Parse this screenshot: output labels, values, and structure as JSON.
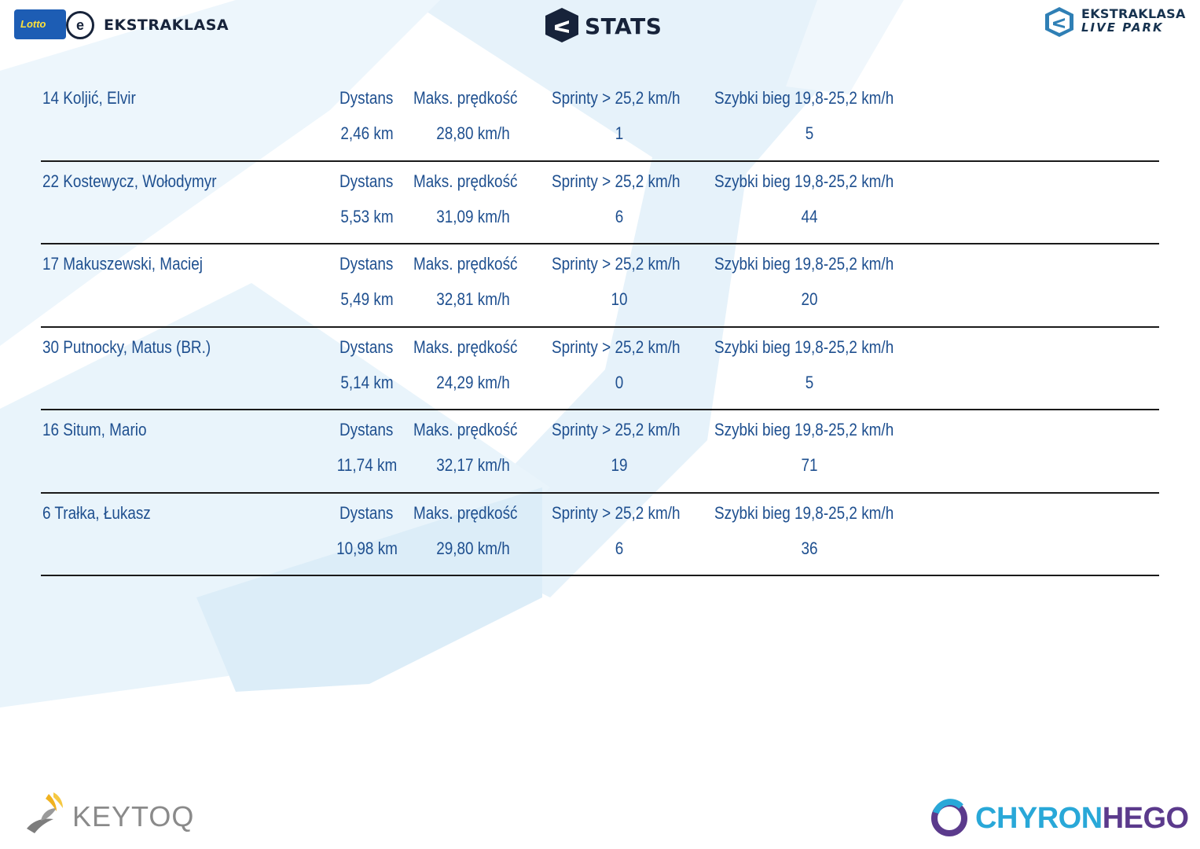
{
  "header": {
    "left_logo": {
      "badge_text": "Lotto",
      "ball_letter": "e",
      "name": "EKSTRAKLASA"
    },
    "center_logo": {
      "text": "STATS"
    },
    "right_logo": {
      "line1": "EKSTRAKLASA",
      "line2": "LIVE PARK"
    }
  },
  "players": [
    {
      "name": "14  Koljić, Elvir",
      "dist_label": "Dystans",
      "max_label": "Maks. prędkość",
      "spr_label": "Sprinty > 25,2 km/h",
      "fast_label": "Szybki bieg 19,8-25,2 km/h",
      "dist": "2,46 km",
      "max": "28,80 km/h",
      "spr": "1",
      "fast": "5"
    },
    {
      "name": "22  Kostewycz, Wołodymyr",
      "dist_label": "Dystans",
      "max_label": "Maks. prędkość",
      "spr_label": "Sprinty > 25,2 km/h",
      "fast_label": "Szybki bieg 19,8-25,2 km/h",
      "dist": "5,53 km",
      "max": "31,09 km/h",
      "spr": "6",
      "fast": "44"
    },
    {
      "name": "17  Makuszewski, Maciej",
      "dist_label": "Dystans",
      "max_label": "Maks. prędkość",
      "spr_label": "Sprinty > 25,2 km/h",
      "fast_label": "Szybki bieg 19,8-25,2 km/h",
      "dist": "5,49 km",
      "max": "32,81 km/h",
      "spr": "10",
      "fast": "20"
    },
    {
      "name": "30  Putnocky, Matus (BR.)",
      "dist_label": "Dystans",
      "max_label": "Maks. prędkość",
      "spr_label": "Sprinty > 25,2 km/h",
      "fast_label": "Szybki bieg 19,8-25,2 km/h",
      "dist": "5,14 km",
      "max": "24,29 km/h",
      "spr": "0",
      "fast": "5"
    },
    {
      "name": "16  Situm, Mario",
      "dist_label": "Dystans",
      "max_label": "Maks. prędkość",
      "spr_label": "Sprinty > 25,2 km/h",
      "fast_label": "Szybki bieg 19,8-25,2 km/h",
      "dist": "11,74 km",
      "max": "32,17 km/h",
      "spr": "19",
      "fast": "71"
    },
    {
      "name": "6  Trałka, Łukasz",
      "dist_label": "Dystans",
      "max_label": "Maks. prędkość",
      "spr_label": "Sprinty > 25,2 km/h",
      "fast_label": "Szybki bieg 19,8-25,2 km/h",
      "dist": "10,98 km",
      "max": "29,80 km/h",
      "spr": "6",
      "fast": "36"
    }
  ],
  "footer": {
    "keytoq": "KEYTOQ",
    "chyron_part1": "CHYRON",
    "chyron_part2": "HEGO"
  },
  "colors": {
    "text_blue": "#1e4f8f",
    "background_shape": "#e8f3fa",
    "divider": "#1a1a1a"
  }
}
